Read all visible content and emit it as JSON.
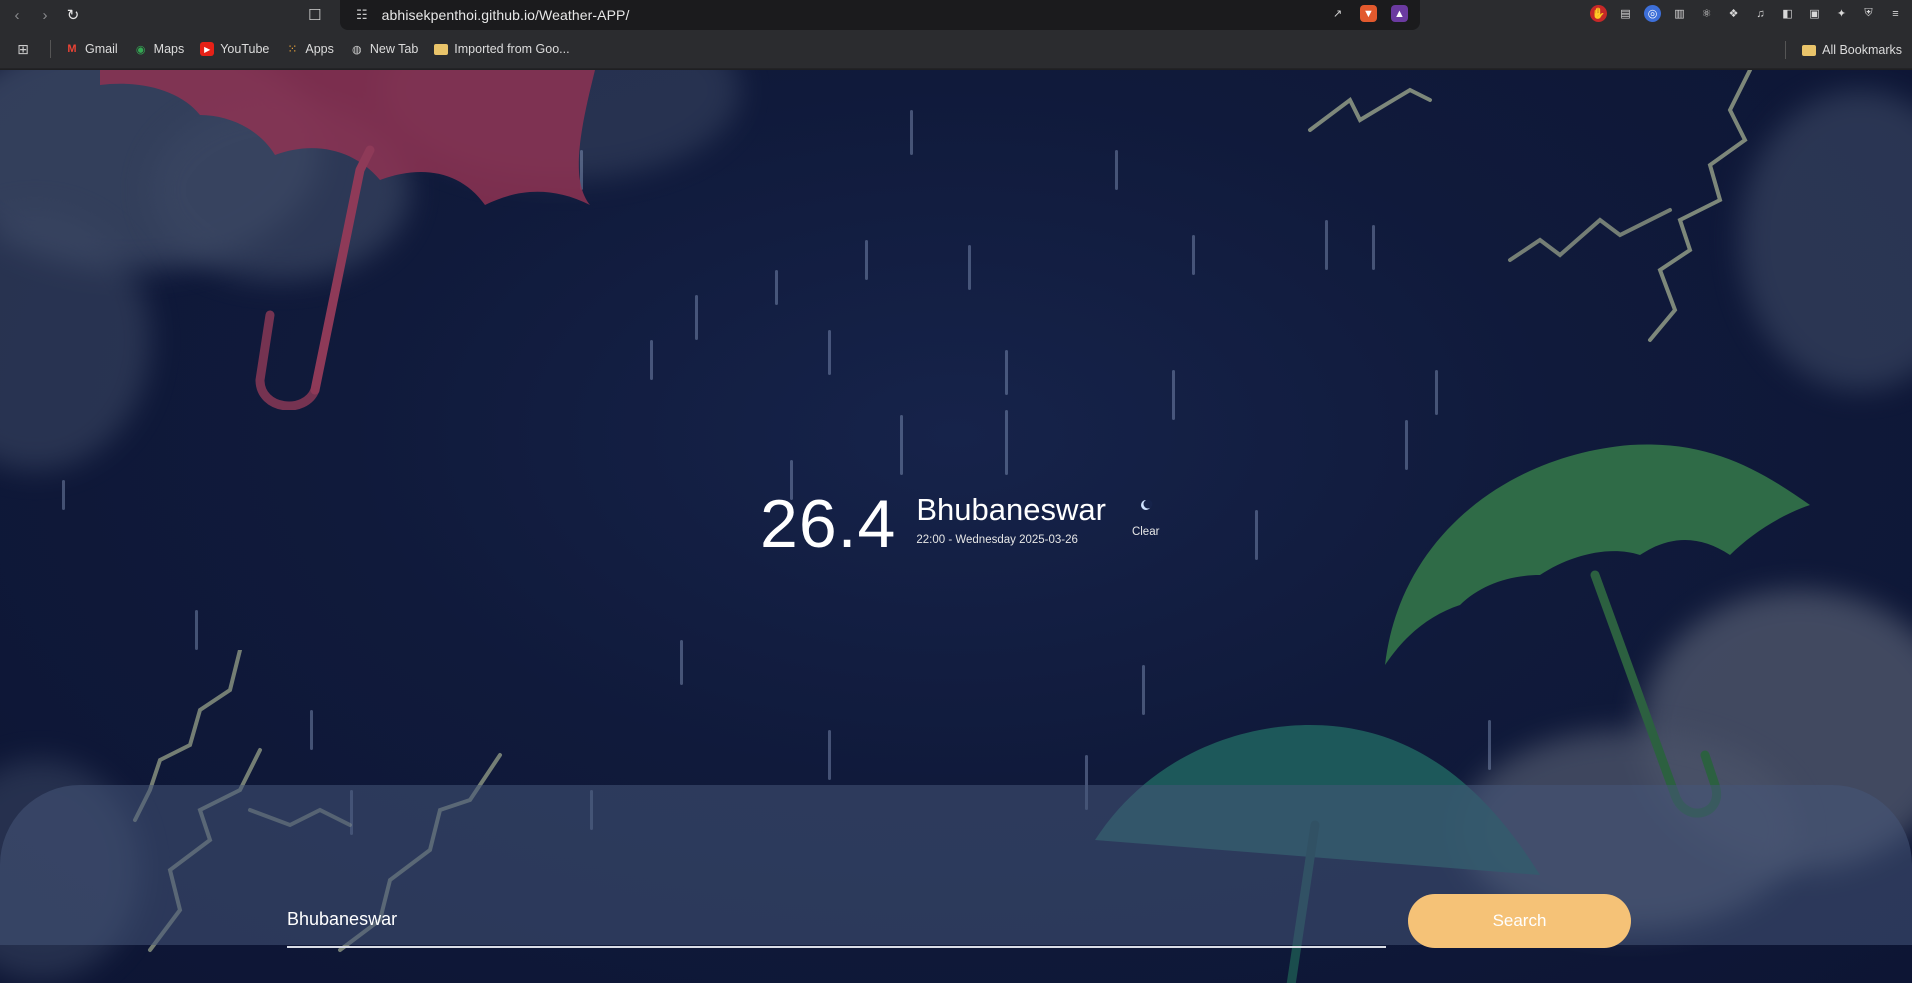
{
  "browser": {
    "url": "abhisekpenthoi.github.io/Weather-APP/",
    "bookmarks": [
      {
        "label": "Gmail",
        "icon": "gmail-icon"
      },
      {
        "label": "Maps",
        "icon": "maps-icon"
      },
      {
        "label": "YouTube",
        "icon": "youtube-icon"
      },
      {
        "label": "Apps",
        "icon": "apps-grid-icon"
      },
      {
        "label": "New Tab",
        "icon": "globe-icon"
      },
      {
        "label": "Imported from Goo...",
        "icon": "folder-icon"
      }
    ],
    "all_bookmarks_label": "All Bookmarks"
  },
  "weather": {
    "temperature": "26.4",
    "city": "Bhubaneswar",
    "datetime": "22:00 - Wednesday 2025-03-26",
    "condition": "Clear",
    "condition_icon": "moon-icon"
  },
  "search": {
    "value": "Bhubaneswar",
    "button_label": "Search"
  },
  "colors": {
    "background": "#101a3b",
    "panel": "#46557a",
    "button": "#f5c277",
    "umbrella_red": "#8e3252",
    "umbrella_green": "#2f6b47",
    "umbrella_teal": "#1f5f5e"
  }
}
